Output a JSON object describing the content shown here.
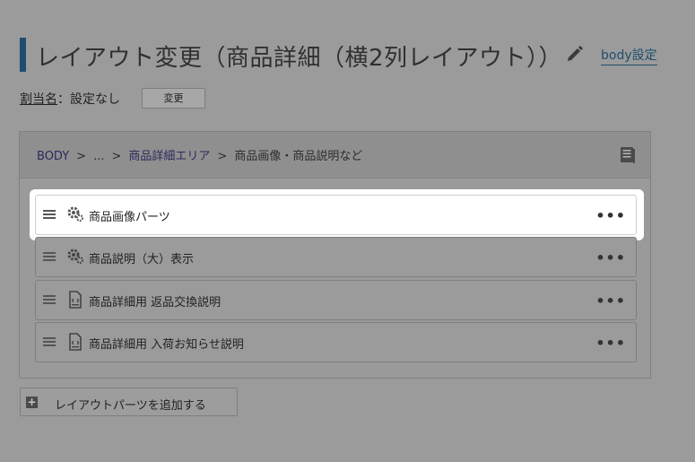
{
  "header": {
    "title": "レイアウト変更（商品詳細（横2列レイアウト））",
    "body_setting_label": "body設定"
  },
  "assignment": {
    "label": "割当名",
    "separator": "：",
    "value": "設定なし",
    "change_label": "変更"
  },
  "breadcrumb": {
    "items": [
      "BODY",
      "...",
      "商品詳細エリア",
      "商品画像・商品説明など"
    ],
    "separator": ">"
  },
  "parts": [
    {
      "label": "商品画像パーツ",
      "icon": "gears-icon",
      "selected": true
    },
    {
      "label": "商品説明（大）表示",
      "icon": "gears-icon",
      "selected": false
    },
    {
      "label": "商品詳細用 返品交換説明",
      "icon": "html-document-icon",
      "selected": false
    },
    {
      "label": "商品詳細用 入荷お知らせ説明",
      "icon": "html-document-icon",
      "selected": false
    }
  ],
  "more_label": "•••",
  "add_part": {
    "label": "レイアウトパーツを追加する",
    "icon_glyph": "+"
  },
  "colors": {
    "accent": "#1f4d6e",
    "overlay": "#9b9b9b",
    "highlight": "#ffffff"
  }
}
